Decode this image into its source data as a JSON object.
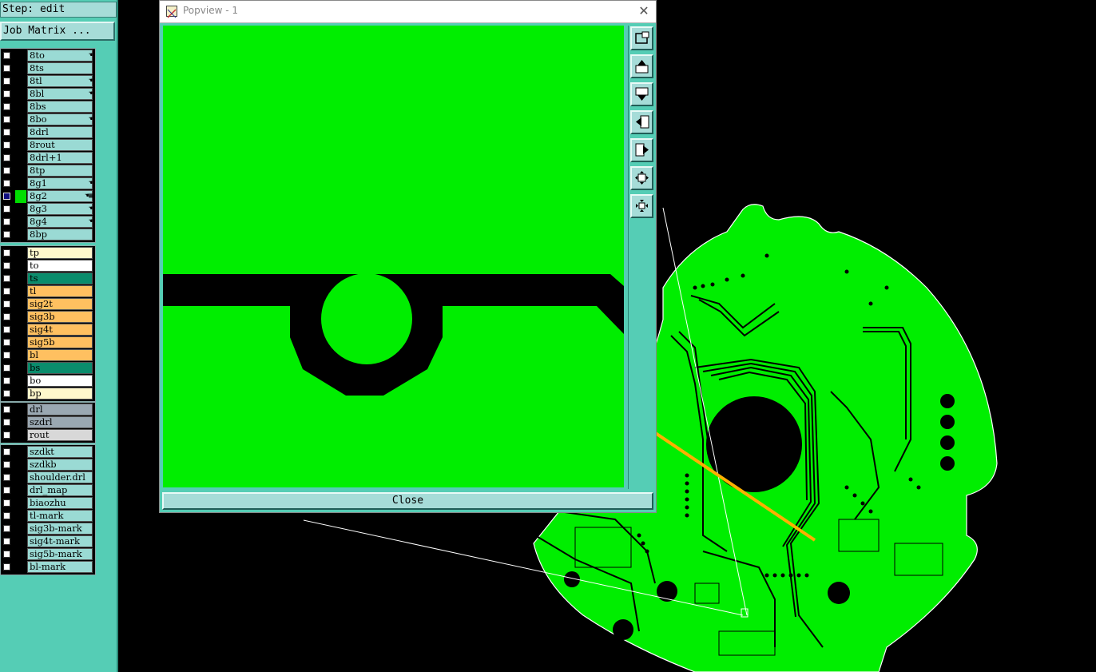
{
  "app": {
    "step_label": "Step: edit",
    "job_matrix_button": "Job Matrix ..."
  },
  "layer_groups": [
    [
      {
        "name": "8to",
        "color": "#9adad4",
        "mark": "hand-icon"
      },
      {
        "name": "8ts",
        "color": "#9adad4",
        "mark": ""
      },
      {
        "name": "8tl",
        "color": "#9adad4",
        "mark": "hand-icon"
      },
      {
        "name": "8bl",
        "color": "#9adad4",
        "mark": "hand-icon"
      },
      {
        "name": "8bs",
        "color": "#9adad4",
        "mark": ""
      },
      {
        "name": "8bo",
        "color": "#9adad4",
        "mark": "hand-icon"
      },
      {
        "name": "8drl",
        "color": "#9adad4",
        "mark": ""
      },
      {
        "name": "8rout",
        "color": "#9adad4",
        "mark": ""
      },
      {
        "name": "8drl+1",
        "color": "#9adad4",
        "mark": ""
      },
      {
        "name": "8tp",
        "color": "#9adad4",
        "mark": ""
      },
      {
        "name": "8g1",
        "color": "#9adad4",
        "mark": "hand-icon"
      },
      {
        "name": "8g2",
        "color": "#9adad4",
        "mark": "hand-grid-icon",
        "active": true
      },
      {
        "name": "8g3",
        "color": "#9adad4",
        "mark": "hand-icon"
      },
      {
        "name": "8g4",
        "color": "#9adad4",
        "mark": "hand-icon"
      },
      {
        "name": "8bp",
        "color": "#9adad4",
        "mark": ""
      }
    ],
    [
      {
        "name": "tp",
        "color": "#fff8cc",
        "mark": ""
      },
      {
        "name": "to",
        "color": "#ffffff",
        "mark": ""
      },
      {
        "name": "ts",
        "color": "#0a8c6c",
        "mark": ""
      },
      {
        "name": "tl",
        "color": "#ffc060",
        "mark": ""
      },
      {
        "name": "sig2t",
        "color": "#ffc060",
        "mark": ""
      },
      {
        "name": "sig3b",
        "color": "#ffc060",
        "mark": ""
      },
      {
        "name": "sig4t",
        "color": "#ffc060",
        "mark": ""
      },
      {
        "name": "sig5b",
        "color": "#ffc060",
        "mark": ""
      },
      {
        "name": "bl",
        "color": "#ffc060",
        "mark": ""
      },
      {
        "name": "bs",
        "color": "#0a8c6c",
        "mark": ""
      },
      {
        "name": "bo",
        "color": "#ffffff",
        "mark": ""
      },
      {
        "name": "bp",
        "color": "#fff8cc",
        "mark": ""
      }
    ],
    [
      {
        "name": "drl",
        "color": "#9aa8b2",
        "mark": ""
      },
      {
        "name": "szdrl",
        "color": "#9aa8b2",
        "mark": ""
      },
      {
        "name": "rout",
        "color": "#d8d8d8",
        "mark": ""
      }
    ],
    [
      {
        "name": "szdkt",
        "color": "#9adad4",
        "mark": ""
      },
      {
        "name": "szdkb",
        "color": "#9adad4",
        "mark": ""
      },
      {
        "name": "shoulder.drl",
        "color": "#9adad4",
        "mark": ""
      },
      {
        "name": "drl_map",
        "color": "#9adad4",
        "mark": ""
      },
      {
        "name": "biaozhu",
        "color": "#9adad4",
        "mark": ""
      },
      {
        "name": "tl-mark",
        "color": "#9adad4",
        "mark": ""
      },
      {
        "name": "sig3b-mark",
        "color": "#9adad4",
        "mark": ""
      },
      {
        "name": "sig4t-mark",
        "color": "#9adad4",
        "mark": ""
      },
      {
        "name": "sig5b-mark",
        "color": "#9adad4",
        "mark": ""
      },
      {
        "name": "bl-mark",
        "color": "#9adad4",
        "mark": ""
      }
    ]
  ],
  "popview": {
    "title": "Popview - 1",
    "close_label": "Close",
    "tools": [
      "zoom-window-icon",
      "move-up-icon",
      "move-down-icon",
      "move-left-icon",
      "move-right-icon",
      "zoom-in-icon",
      "zoom-out-icon"
    ]
  },
  "colors": {
    "panel": "#55cdb5",
    "button": "#a6dcd8",
    "copper": "#00ee00",
    "arrow": "#ffb000",
    "active_swatch": "#00dd00"
  }
}
